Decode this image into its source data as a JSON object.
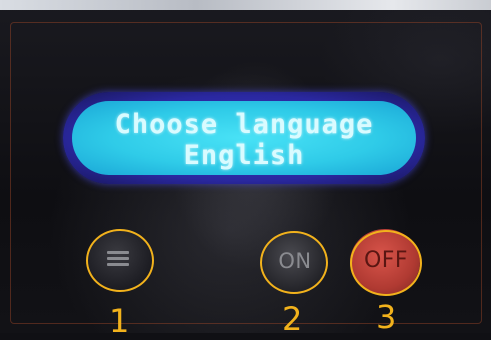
{
  "lcd": {
    "line1": "Choose language",
    "line2": "English"
  },
  "buttons": {
    "menu_icon": "menu-icon",
    "on_label": "ON",
    "off_label": "OFF"
  },
  "callouts": {
    "one": "1",
    "two": "2",
    "three": "3"
  },
  "colors": {
    "lcd_background": "#2fcbe8",
    "lcd_text": "#d9fbff",
    "lcd_bezel": "#2a28a0",
    "callout": "#f2b21c",
    "off_button": "#b03a32"
  }
}
